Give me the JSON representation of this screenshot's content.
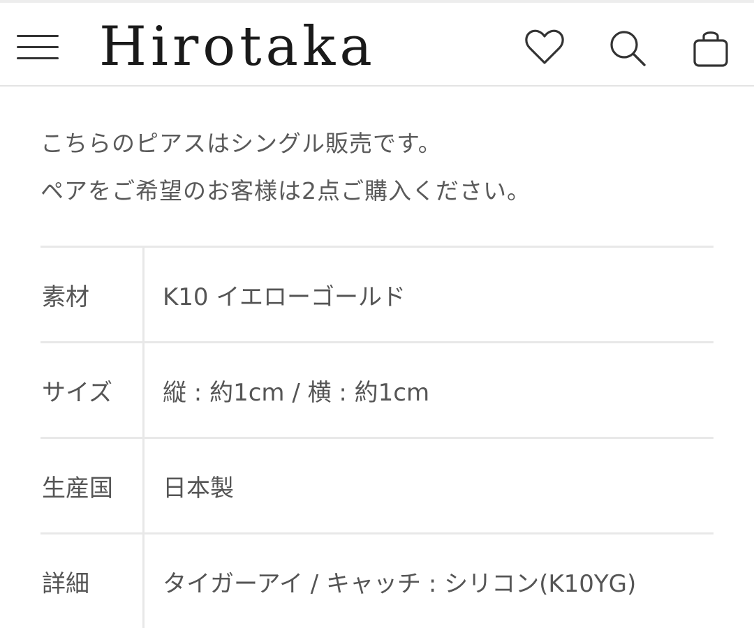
{
  "header": {
    "logo": "Hirotaka",
    "menu_icon": "hamburger-menu-icon",
    "wishlist_icon": "heart-icon",
    "search_icon": "search-icon",
    "cart_icon": "shopping-bag-icon"
  },
  "notice": {
    "line1": "こちらのピアスはシングル販売です。",
    "line2": "ペアをご希望のお客様は2点ご購入ください。"
  },
  "spec_table": {
    "rows": [
      {
        "label": "素材",
        "value": "K10 イエローゴールド"
      },
      {
        "label": "サイズ",
        "value": "縦 : 約1cm / 横 : 約1cm"
      },
      {
        "label": "生産国",
        "value": "日本製"
      },
      {
        "label": "詳細",
        "value": "タイガーアイ / キャッチ : シリコン(K10YG)"
      }
    ]
  },
  "colors": {
    "text": "#555555",
    "logo": "#1a1a1a",
    "divider": "#e8e8e8"
  }
}
